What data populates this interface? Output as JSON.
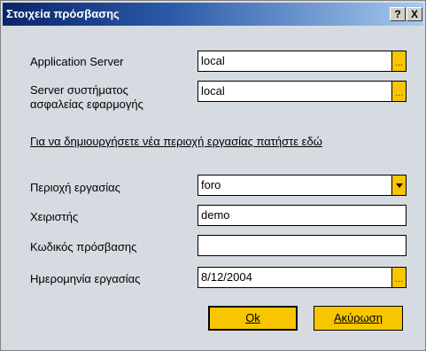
{
  "window": {
    "title": "Στοιχεία πρόσβασης",
    "help_label": "?",
    "close_label": "X"
  },
  "form": {
    "app_server": {
      "label": "Application Server",
      "value": "local",
      "browse_label": "..."
    },
    "security_server": {
      "label_line1": "Server συστήματος",
      "label_line2": "ασφαλείας εφαρμογής",
      "value": "local",
      "browse_label": "..."
    },
    "new_workspace_link": "Για να δημιουργήσετε νέα περιοχή εργασίας πατήστε εδώ",
    "workspace": {
      "label": "Περιοχή εργασίας",
      "value": "foro"
    },
    "user": {
      "label": "Χειριστής",
      "value": "demo"
    },
    "password": {
      "label": "Κωδικός πρόσβασης",
      "value": ""
    },
    "work_date": {
      "label": "Ημερομηνία εργασίας",
      "value": "8/12/2004",
      "browse_label": "..."
    }
  },
  "buttons": {
    "ok_label": "Ok",
    "cancel_label": "Ακύρωση"
  },
  "colors": {
    "accent": "#f7c600",
    "dialog_bg": "#d6dbe2",
    "titlebar_start": "#0a246a",
    "titlebar_end": "#a6caf0"
  }
}
